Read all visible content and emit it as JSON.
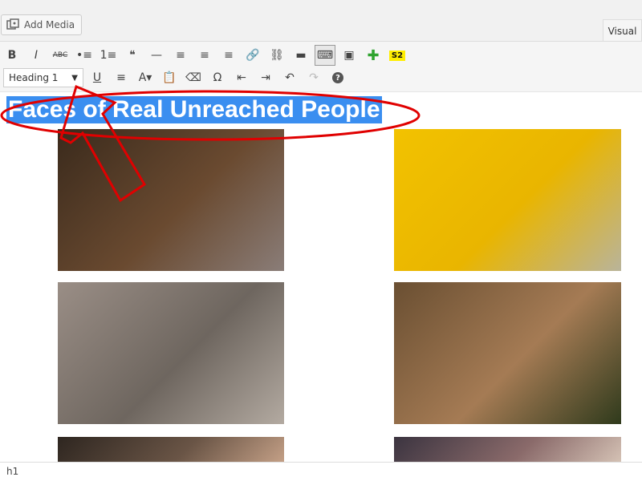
{
  "toolbar_top": {
    "add_media_label": "Add Media",
    "visual_tab_label": "Visual"
  },
  "toolbar": {
    "row1": [
      {
        "name": "bold-button",
        "glyph": "B"
      },
      {
        "name": "italic-button",
        "glyph": "I"
      },
      {
        "name": "strikethrough-button",
        "glyph": "ABC"
      },
      {
        "name": "bulleted-list-button",
        "glyph": "•≡"
      },
      {
        "name": "numbered-list-button",
        "glyph": "1≡"
      },
      {
        "name": "blockquote-button",
        "glyph": "❝"
      },
      {
        "name": "horizontal-line-button",
        "glyph": "—"
      },
      {
        "name": "align-left-button",
        "glyph": "≡"
      },
      {
        "name": "align-center-button",
        "glyph": "≡"
      },
      {
        "name": "align-right-button",
        "glyph": "≡"
      },
      {
        "name": "insert-link-button",
        "glyph": "🔗"
      },
      {
        "name": "remove-link-button",
        "glyph": "⛓"
      },
      {
        "name": "read-more-button",
        "glyph": "▬"
      },
      {
        "name": "toolbar-toggle-button",
        "glyph": "⌨"
      },
      {
        "name": "add-gallery-button",
        "glyph": "▣"
      },
      {
        "name": "plugin-plus-button",
        "glyph": "✚"
      },
      {
        "name": "s2-button",
        "glyph": "S2"
      }
    ],
    "format_select_value": "Heading 1",
    "row2": [
      {
        "name": "underline-button",
        "glyph": "U"
      },
      {
        "name": "justify-button",
        "glyph": "≡"
      },
      {
        "name": "text-color-button",
        "glyph": "A▾"
      },
      {
        "name": "paste-as-text-button",
        "glyph": "📋"
      },
      {
        "name": "clear-formatting-button",
        "glyph": "⌫"
      },
      {
        "name": "special-character-button",
        "glyph": "Ω"
      },
      {
        "name": "outdent-button",
        "glyph": "⇤"
      },
      {
        "name": "indent-button",
        "glyph": "⇥"
      },
      {
        "name": "undo-button",
        "glyph": "↶"
      },
      {
        "name": "redo-button",
        "glyph": "↷"
      },
      {
        "name": "help-button",
        "glyph": "?"
      }
    ]
  },
  "content": {
    "heading": "Faces of Real Unreached People"
  },
  "photos": [
    {
      "name": "photo-elderly-woman",
      "colors": [
        "#3a2a1c",
        "#6a4a30",
        "#8a7d78"
      ]
    },
    {
      "name": "photo-child-yellow-wall",
      "colors": [
        "#f2c200",
        "#e9b500",
        "#b9b49a"
      ]
    },
    {
      "name": "photo-man-on-steps",
      "colors": [
        "#9a8e86",
        "#6e665f",
        "#b3aaa1"
      ]
    },
    {
      "name": "photo-boy-with-monkey",
      "colors": [
        "#6a4f32",
        "#a57b54",
        "#2f3a1c"
      ]
    },
    {
      "name": "photo-man-closeup",
      "colors": [
        "#2e2620",
        "#6a5546",
        "#c9a48a"
      ]
    },
    {
      "name": "photo-group-partial",
      "colors": [
        "#3b3440",
        "#8a6a6a",
        "#d9c7b9"
      ]
    }
  ],
  "status": {
    "path": "h1"
  },
  "colors": {
    "annotation_red": "#e00000",
    "selection_blue": "#3a8ef0"
  }
}
